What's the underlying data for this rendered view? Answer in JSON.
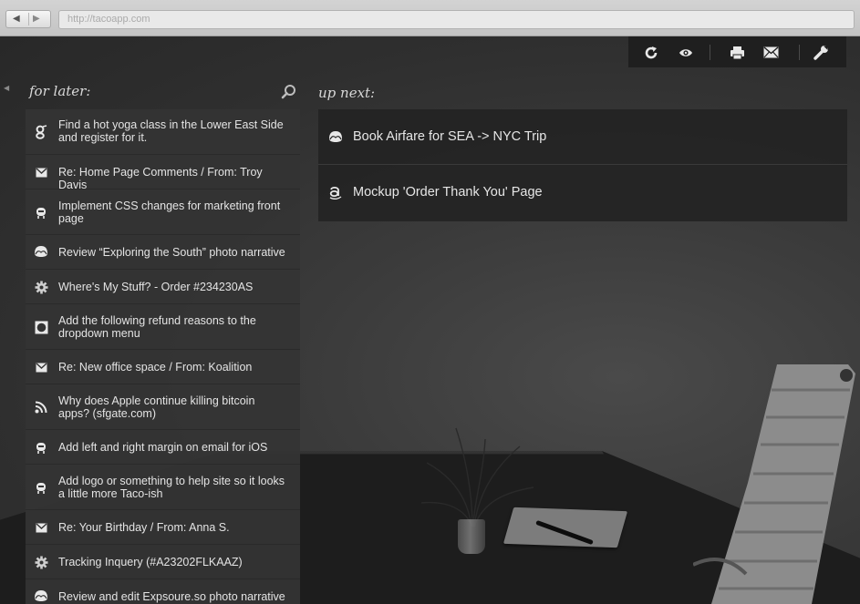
{
  "browser": {
    "url": "http://tacoapp.com",
    "back_icon": "back-arrow-icon",
    "forward_icon": "forward-arrow-icon"
  },
  "toolbar": {
    "buttons": [
      "refresh-icon",
      "eye-icon",
      "print-icon",
      "mail-icon",
      "wrench-icon"
    ]
  },
  "for_later": {
    "title": "for later:",
    "search_icon": "search-icon",
    "items": [
      {
        "icon": "google-icon",
        "text": "Find a hot yoga class in the Lower East Side and register for it."
      },
      {
        "icon": "mail-icon",
        "text": "Re: Home Page Comments / From: Troy Davis"
      },
      {
        "icon": "github-icon",
        "text": "Implement CSS changes for marketing front page"
      },
      {
        "icon": "basecamp-icon",
        "text": "Review “Exploring the South” photo narrative"
      },
      {
        "icon": "gear-icon",
        "text": "Where's My Stuff? - Order #234230AS"
      },
      {
        "icon": "square-circle-icon",
        "text": "Add the following refund reasons to the dropdown menu"
      },
      {
        "icon": "mail-icon",
        "text": "Re: New office space / From: Koalition"
      },
      {
        "icon": "rss-icon",
        "text": "Why does Apple continue killing bitcoin apps? (sfgate.com)"
      },
      {
        "icon": "github-icon",
        "text": "Add left and right margin on email for iOS"
      },
      {
        "icon": "github-icon",
        "text": "Add logo or something to help site so it looks a little more Taco-ish"
      },
      {
        "icon": "mail-icon",
        "text": "Re: Your Birthday / From: Anna S."
      },
      {
        "icon": "gear-icon",
        "text": "Tracking Inquery (#A23202FLKAAZ)"
      },
      {
        "icon": "basecamp-icon",
        "text": "Review and edit Expsoure.so photo narrative"
      }
    ]
  },
  "up_next": {
    "title": "up next:",
    "items": [
      {
        "icon": "basecamp-icon",
        "text": "Book Airfare for SEA -> NYC Trip"
      },
      {
        "icon": "amazon-icon",
        "text": "Mockup 'Order Thank You' Page"
      }
    ]
  }
}
